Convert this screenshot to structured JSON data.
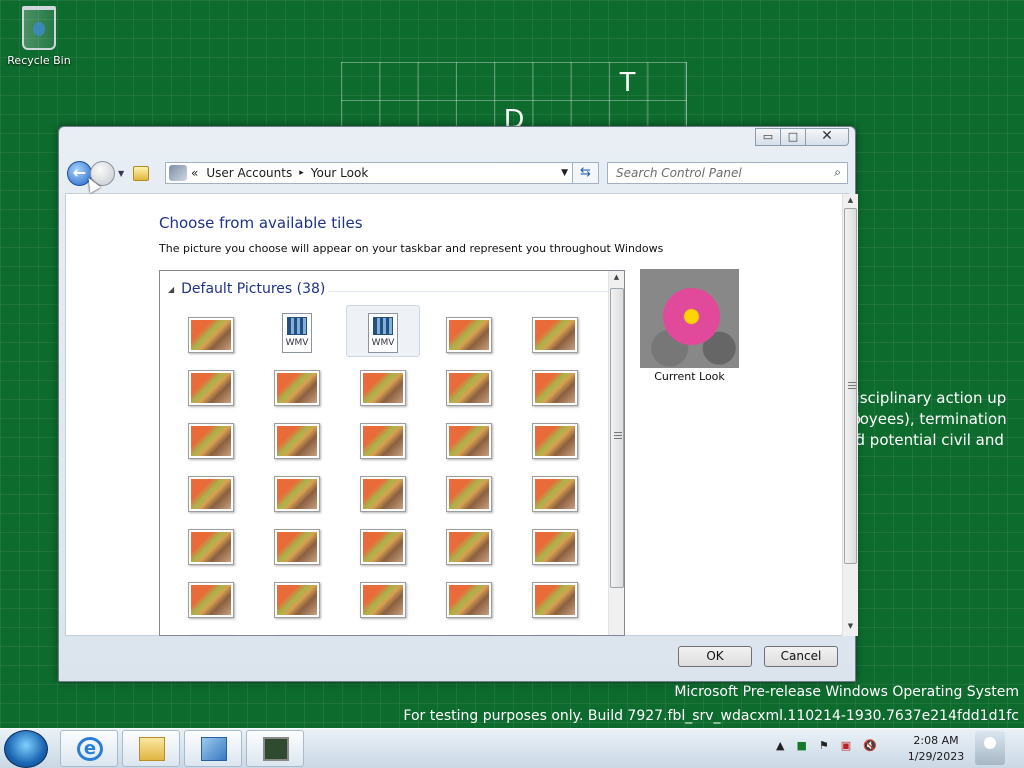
{
  "desktop": {
    "recycle_bin_label": "Recycle Bin",
    "grid_letters": [
      "T",
      "D"
    ],
    "background_text": [
      "disciplinary action up to",
      "ployees), termination of",
      "nd potential civil and"
    ],
    "watermark": [
      "Microsoft Pre-release Windows Operating System",
      "For testing purposes only. Build 7927.fbl_srv_wdacxml.110214-1930.7637e214fdd1d1fc"
    ]
  },
  "window": {
    "controls": {
      "minimize": "▭",
      "maximize": "□",
      "close": "✕"
    },
    "nav": {
      "back_icon": "back-arrow-icon",
      "forward_icon": "forward-arrow-icon"
    },
    "address": {
      "prefix": "«",
      "crumb_1": "User Accounts",
      "separator": "▸",
      "crumb_2": "Your Look"
    },
    "search_placeholder": "Search Control Panel",
    "heading": "Choose from available tiles",
    "description": "The picture you choose will appear on your taskbar and represent you throughout Windows",
    "group_header": "Default Pictures (38)",
    "wmv_label": "WMV",
    "current_label": "Current Look",
    "ok_label": "OK",
    "cancel_label": "Cancel"
  },
  "taskbar": {
    "clock_time": "2:08 AM",
    "clock_date": "1/29/2023",
    "tray": [
      "▲",
      "■",
      "⚑",
      "▣",
      "🔇"
    ]
  },
  "colors": {
    "accent": "#1e3287",
    "desktop": "#0e6b2e"
  }
}
